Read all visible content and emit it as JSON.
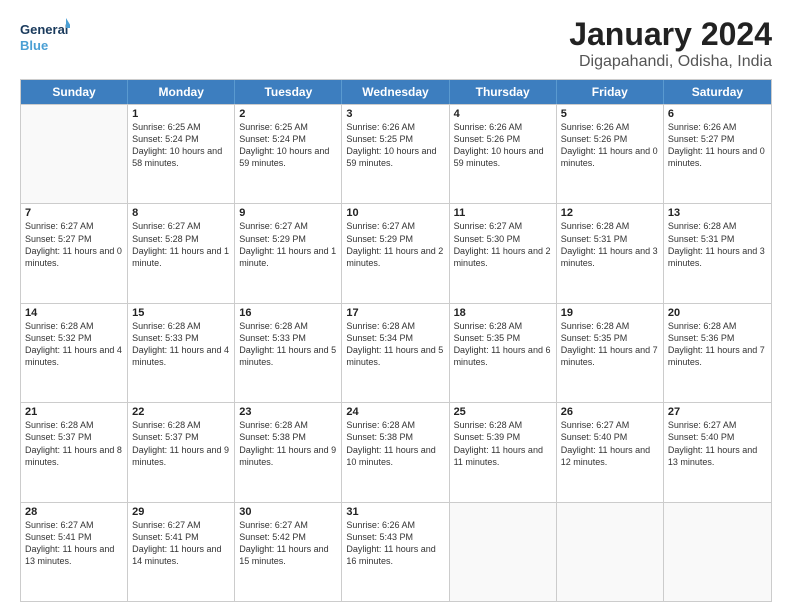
{
  "logo": {
    "line1": "General",
    "line2": "Blue"
  },
  "title": "January 2024",
  "subtitle": "Digapahandi, Odisha, India",
  "days": [
    "Sunday",
    "Monday",
    "Tuesday",
    "Wednesday",
    "Thursday",
    "Friday",
    "Saturday"
  ],
  "weeks": [
    [
      {
        "day": "",
        "sunrise": "",
        "sunset": "",
        "daylight": ""
      },
      {
        "day": "1",
        "sunrise": "Sunrise: 6:25 AM",
        "sunset": "Sunset: 5:24 PM",
        "daylight": "Daylight: 10 hours and 58 minutes."
      },
      {
        "day": "2",
        "sunrise": "Sunrise: 6:25 AM",
        "sunset": "Sunset: 5:24 PM",
        "daylight": "Daylight: 10 hours and 59 minutes."
      },
      {
        "day": "3",
        "sunrise": "Sunrise: 6:26 AM",
        "sunset": "Sunset: 5:25 PM",
        "daylight": "Daylight: 10 hours and 59 minutes."
      },
      {
        "day": "4",
        "sunrise": "Sunrise: 6:26 AM",
        "sunset": "Sunset: 5:26 PM",
        "daylight": "Daylight: 10 hours and 59 minutes."
      },
      {
        "day": "5",
        "sunrise": "Sunrise: 6:26 AM",
        "sunset": "Sunset: 5:26 PM",
        "daylight": "Daylight: 11 hours and 0 minutes."
      },
      {
        "day": "6",
        "sunrise": "Sunrise: 6:26 AM",
        "sunset": "Sunset: 5:27 PM",
        "daylight": "Daylight: 11 hours and 0 minutes."
      }
    ],
    [
      {
        "day": "7",
        "sunrise": "Sunrise: 6:27 AM",
        "sunset": "Sunset: 5:27 PM",
        "daylight": "Daylight: 11 hours and 0 minutes."
      },
      {
        "day": "8",
        "sunrise": "Sunrise: 6:27 AM",
        "sunset": "Sunset: 5:28 PM",
        "daylight": "Daylight: 11 hours and 1 minute."
      },
      {
        "day": "9",
        "sunrise": "Sunrise: 6:27 AM",
        "sunset": "Sunset: 5:29 PM",
        "daylight": "Daylight: 11 hours and 1 minute."
      },
      {
        "day": "10",
        "sunrise": "Sunrise: 6:27 AM",
        "sunset": "Sunset: 5:29 PM",
        "daylight": "Daylight: 11 hours and 2 minutes."
      },
      {
        "day": "11",
        "sunrise": "Sunrise: 6:27 AM",
        "sunset": "Sunset: 5:30 PM",
        "daylight": "Daylight: 11 hours and 2 minutes."
      },
      {
        "day": "12",
        "sunrise": "Sunrise: 6:28 AM",
        "sunset": "Sunset: 5:31 PM",
        "daylight": "Daylight: 11 hours and 3 minutes."
      },
      {
        "day": "13",
        "sunrise": "Sunrise: 6:28 AM",
        "sunset": "Sunset: 5:31 PM",
        "daylight": "Daylight: 11 hours and 3 minutes."
      }
    ],
    [
      {
        "day": "14",
        "sunrise": "Sunrise: 6:28 AM",
        "sunset": "Sunset: 5:32 PM",
        "daylight": "Daylight: 11 hours and 4 minutes."
      },
      {
        "day": "15",
        "sunrise": "Sunrise: 6:28 AM",
        "sunset": "Sunset: 5:33 PM",
        "daylight": "Daylight: 11 hours and 4 minutes."
      },
      {
        "day": "16",
        "sunrise": "Sunrise: 6:28 AM",
        "sunset": "Sunset: 5:33 PM",
        "daylight": "Daylight: 11 hours and 5 minutes."
      },
      {
        "day": "17",
        "sunrise": "Sunrise: 6:28 AM",
        "sunset": "Sunset: 5:34 PM",
        "daylight": "Daylight: 11 hours and 5 minutes."
      },
      {
        "day": "18",
        "sunrise": "Sunrise: 6:28 AM",
        "sunset": "Sunset: 5:35 PM",
        "daylight": "Daylight: 11 hours and 6 minutes."
      },
      {
        "day": "19",
        "sunrise": "Sunrise: 6:28 AM",
        "sunset": "Sunset: 5:35 PM",
        "daylight": "Daylight: 11 hours and 7 minutes."
      },
      {
        "day": "20",
        "sunrise": "Sunrise: 6:28 AM",
        "sunset": "Sunset: 5:36 PM",
        "daylight": "Daylight: 11 hours and 7 minutes."
      }
    ],
    [
      {
        "day": "21",
        "sunrise": "Sunrise: 6:28 AM",
        "sunset": "Sunset: 5:37 PM",
        "daylight": "Daylight: 11 hours and 8 minutes."
      },
      {
        "day": "22",
        "sunrise": "Sunrise: 6:28 AM",
        "sunset": "Sunset: 5:37 PM",
        "daylight": "Daylight: 11 hours and 9 minutes."
      },
      {
        "day": "23",
        "sunrise": "Sunrise: 6:28 AM",
        "sunset": "Sunset: 5:38 PM",
        "daylight": "Daylight: 11 hours and 9 minutes."
      },
      {
        "day": "24",
        "sunrise": "Sunrise: 6:28 AM",
        "sunset": "Sunset: 5:38 PM",
        "daylight": "Daylight: 11 hours and 10 minutes."
      },
      {
        "day": "25",
        "sunrise": "Sunrise: 6:28 AM",
        "sunset": "Sunset: 5:39 PM",
        "daylight": "Daylight: 11 hours and 11 minutes."
      },
      {
        "day": "26",
        "sunrise": "Sunrise: 6:27 AM",
        "sunset": "Sunset: 5:40 PM",
        "daylight": "Daylight: 11 hours and 12 minutes."
      },
      {
        "day": "27",
        "sunrise": "Sunrise: 6:27 AM",
        "sunset": "Sunset: 5:40 PM",
        "daylight": "Daylight: 11 hours and 13 minutes."
      }
    ],
    [
      {
        "day": "28",
        "sunrise": "Sunrise: 6:27 AM",
        "sunset": "Sunset: 5:41 PM",
        "daylight": "Daylight: 11 hours and 13 minutes."
      },
      {
        "day": "29",
        "sunrise": "Sunrise: 6:27 AM",
        "sunset": "Sunset: 5:41 PM",
        "daylight": "Daylight: 11 hours and 14 minutes."
      },
      {
        "day": "30",
        "sunrise": "Sunrise: 6:27 AM",
        "sunset": "Sunset: 5:42 PM",
        "daylight": "Daylight: 11 hours and 15 minutes."
      },
      {
        "day": "31",
        "sunrise": "Sunrise: 6:26 AM",
        "sunset": "Sunset: 5:43 PM",
        "daylight": "Daylight: 11 hours and 16 minutes."
      },
      {
        "day": "",
        "sunrise": "",
        "sunset": "",
        "daylight": ""
      },
      {
        "day": "",
        "sunrise": "",
        "sunset": "",
        "daylight": ""
      },
      {
        "day": "",
        "sunrise": "",
        "sunset": "",
        "daylight": ""
      }
    ]
  ]
}
